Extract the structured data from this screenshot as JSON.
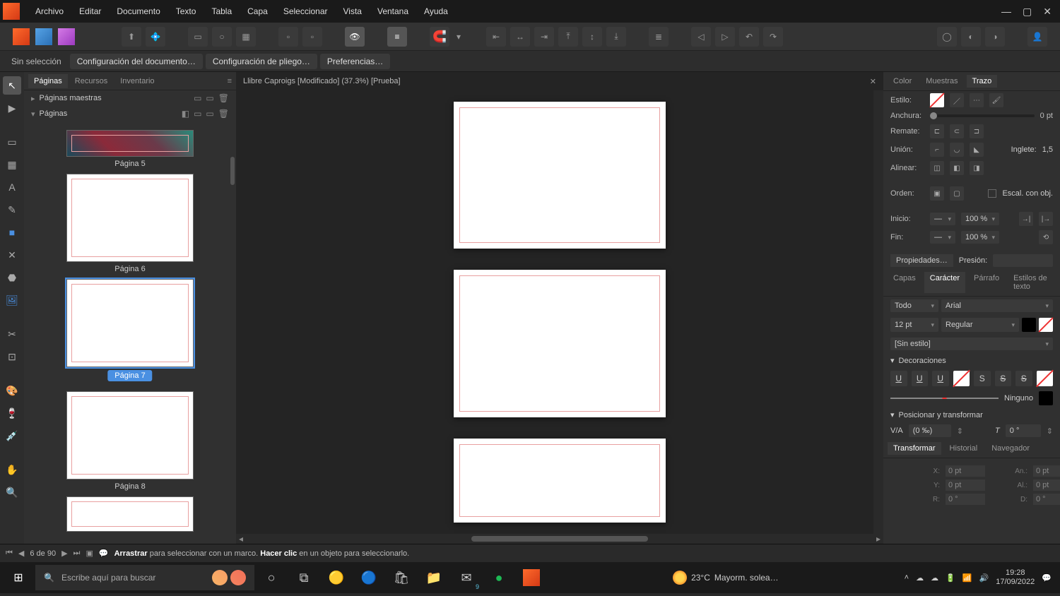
{
  "menubar": [
    "Archivo",
    "Editar",
    "Documento",
    "Texto",
    "Tabla",
    "Capa",
    "Seleccionar",
    "Vista",
    "Ventana",
    "Ayuda"
  ],
  "context": {
    "selection": "Sin selección",
    "buttons": [
      "Configuración del documento…",
      "Configuración de pliego…",
      "Preferencias…"
    ]
  },
  "left_panel": {
    "tabs": [
      "Páginas",
      "Recursos",
      "Inventario"
    ],
    "active_tab": "Páginas",
    "master_pages": "Páginas maestras",
    "pages_label": "Páginas",
    "pages": [
      {
        "label": "Página 5",
        "photo": true
      },
      {
        "label": "Página 6"
      },
      {
        "label": "Página 7",
        "selected": true
      },
      {
        "label": "Página 8"
      },
      {
        "label": ""
      }
    ]
  },
  "doc_tab": "Llibre Caproigs [Modificado] (37.3%) [Prueba]",
  "right": {
    "tabs1": [
      "Color",
      "Muestras",
      "Trazo"
    ],
    "active1": "Trazo",
    "estilo": "Estilo:",
    "anchura": "Anchura:",
    "anchura_val": "0 pt",
    "remate": "Remate:",
    "union": "Unión:",
    "inglete": "Inglete:",
    "inglete_val": "1,5",
    "alinear": "Alinear:",
    "orden": "Orden:",
    "escal": "Escal. con obj.",
    "inicio": "Inicio:",
    "fin": "Fin:",
    "pct": "100 %",
    "propiedades": "Propiedades…",
    "presion": "Presión:",
    "tabs2": [
      "Capas",
      "Carácter",
      "Párrafo",
      "Estilos de texto"
    ],
    "active2": "Carácter",
    "char_scope": "Todo",
    "font": "Arial",
    "size": "12 pt",
    "weight": "Regular",
    "style_none": "[Sin estilo]",
    "decoraciones": "Decoraciones",
    "ninguno": "Ninguno",
    "pos_trans": "Posicionar y transformar",
    "kern": "(0 ‰)",
    "rot": "0 °",
    "tabs3": [
      "Transformar",
      "Historial",
      "Navegador"
    ],
    "active3": "Transformar",
    "transform": {
      "x": "0 pt",
      "y": "0 pt",
      "an": "0 pt",
      "al": "0 pt",
      "r": "0 °",
      "d": "0 °"
    }
  },
  "status": {
    "page_of": "6 de 90",
    "hint_a": "Arrastrar",
    "hint_a2": " para seleccionar con un marco. ",
    "hint_b": "Hacer clic",
    "hint_b2": " en un objeto para seleccionarlo."
  },
  "taskbar": {
    "search_placeholder": "Escribe aquí para buscar",
    "weather_temp": "23°C",
    "weather_desc": "Mayorm. solea…",
    "mail_badge": "9",
    "time": "19:28",
    "date": "17/09/2022"
  }
}
